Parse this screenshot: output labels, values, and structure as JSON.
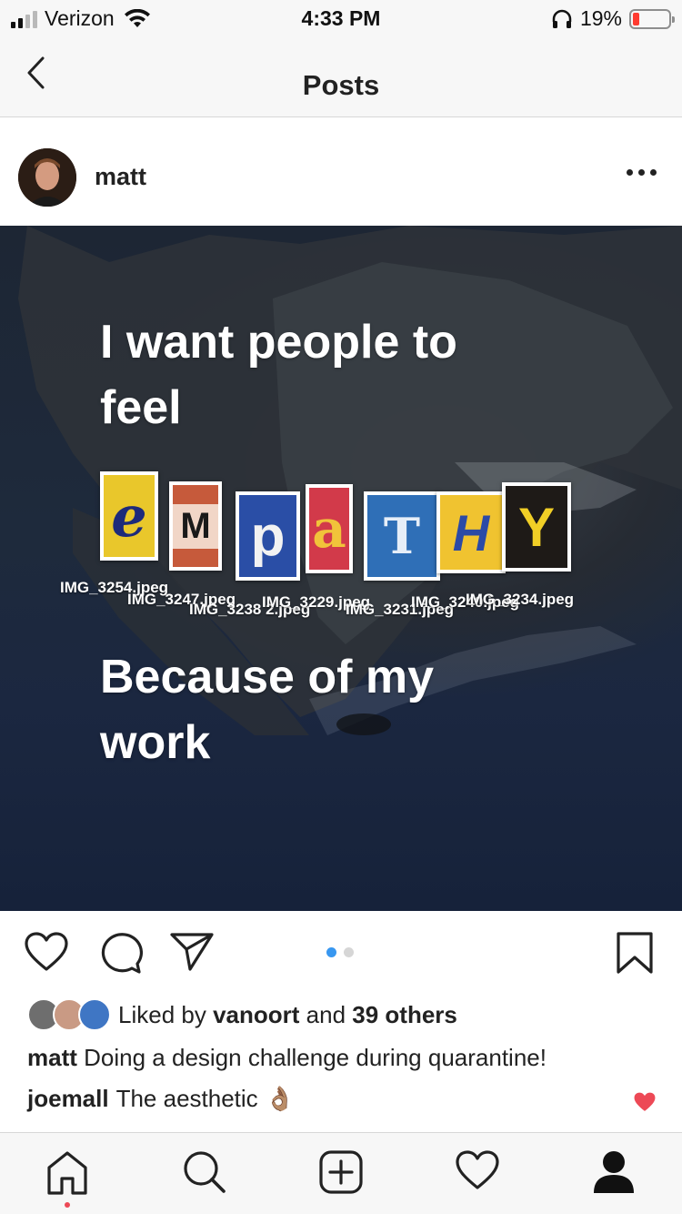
{
  "status_bar": {
    "carrier": "Verizon",
    "time": "4:33 PM",
    "battery_percent": "19%",
    "battery_level": 0.19,
    "signal_bars_active": 2,
    "icons": [
      "signal-icon",
      "wifi-icon",
      "headphones-icon",
      "battery-icon"
    ]
  },
  "nav": {
    "title": "Posts",
    "back_icon": "chevron-left-icon"
  },
  "post": {
    "username": "matt",
    "more_icon": "ellipsis-icon",
    "image_text": {
      "line1": "I want people to",
      "line2": "feel",
      "line3": "Because of my",
      "line4": "work"
    },
    "letters": [
      "e",
      "M",
      "p",
      "a",
      "T",
      "H",
      "Y"
    ],
    "file_labels": [
      "IMG_3254.jpeg",
      "IMG_3247.jpeg",
      "IMG_3238 2.jpeg",
      "IMG_3229.jpeg",
      "IMG_3231.jpeg",
      "IMG_3240.jpeg",
      "IMG_3234.jpeg"
    ],
    "carousel": {
      "count": 2,
      "active": 0
    },
    "likes": {
      "prefix": "Liked by",
      "user": "vanoort",
      "conjunction": "and",
      "others": "39 others"
    },
    "caption": {
      "user": "matt",
      "text": "Doing a design challenge during quarantine!"
    },
    "comment": {
      "user": "joemall",
      "text": "The aesthetic",
      "emoji": "👌🏽"
    }
  },
  "actions": {
    "icons": [
      "heart-icon",
      "comment-icon",
      "share-icon",
      "bookmark-icon"
    ]
  },
  "tabbar": {
    "icons": [
      "home-icon",
      "search-icon",
      "add-post-icon",
      "activity-heart-icon",
      "profile-icon"
    ]
  },
  "colors": {
    "accent_blue": "#3897f0",
    "like_red": "#ed4956",
    "text": "#222222"
  }
}
